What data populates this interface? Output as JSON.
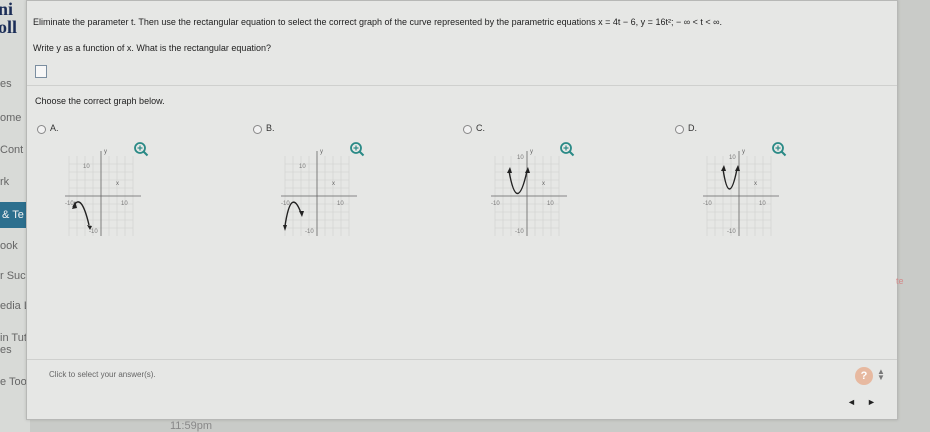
{
  "sidebar": {
    "logo_top": "ni",
    "logo_bottom": "oll",
    "items": [
      "es",
      "ome",
      "Cont",
      "rk",
      "& Te",
      "ook",
      "r Suc",
      "edia Li",
      "in Tuto",
      "es",
      "e Tools"
    ]
  },
  "question": {
    "line1": "Eliminate the parameter t. Then use the rectangular equation to select the correct graph of the curve represented by the parametric equations x = 4t − 6, y = 16t²;  − ∞ < t < ∞.",
    "line2": "Write y as a function of x. What is the rectangular equation?",
    "choose_label": "Choose the correct graph below."
  },
  "options": [
    {
      "label": "A.",
      "ytick": "10",
      "xneg": "-10",
      "xpos": "10",
      "yneg": "-10"
    },
    {
      "label": "B.",
      "ytick": "10",
      "xneg": "-10",
      "xpos": "10",
      "yneg": "-10"
    },
    {
      "label": "C.",
      "ytick": "10",
      "xneg": "-10",
      "xpos": "10",
      "yneg": "-10"
    },
    {
      "label": "D.",
      "ytick": "10",
      "xneg": "-10",
      "xpos": "10",
      "yneg": "-10"
    }
  ],
  "axis": {
    "x": "x",
    "y": "y"
  },
  "footer": {
    "hint": "Click to select your answer(s).",
    "help": "?"
  },
  "nav": {
    "prev": "◄",
    "next": "►"
  },
  "clock": "11:59pm",
  "right_edge": "te",
  "colors": {
    "panel_bg": "#e6e7e5",
    "zoom_icon": "#2a8a86",
    "active_sidebar": "#2c6f8e"
  }
}
